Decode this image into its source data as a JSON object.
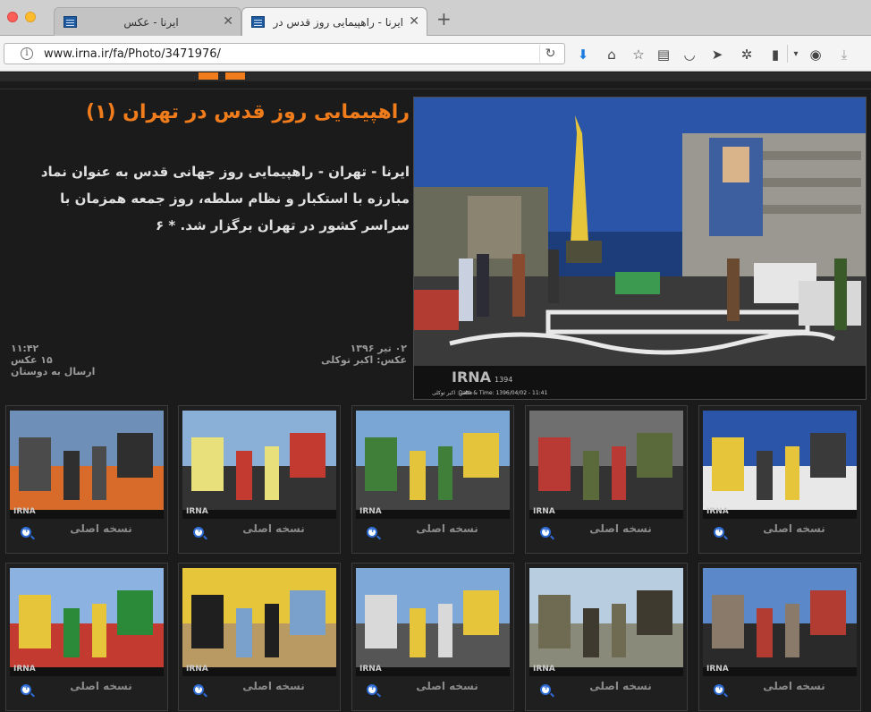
{
  "browser": {
    "tabs": [
      {
        "title": "ایرنا - عکس",
        "active": false
      },
      {
        "title": "ایرنا - راهپیمایی روز قدس در...",
        "active": true
      }
    ],
    "url": "www.irna.ir/fa/Photo/3471976/",
    "icons": [
      "download-icon",
      "home-icon",
      "bookmark-star-icon",
      "reading-list-icon",
      "pocket-icon",
      "send-icon",
      "extension-icon",
      "clipboard-icon",
      "menu-arrow-icon",
      "color-wheel-icon",
      "downloads-icon"
    ]
  },
  "article": {
    "title": "راهپیمایی روز قدس در تهران (۱)",
    "lead": "ایرنا - تهران - راهپیمایی روز جهانی قدس به عنوان نماد مبارزه با استکبار و نظام سلطه، روز جمعه همزمان با سراسر کشور در تهران برگزار شد. * ۶",
    "date": "۰۲ تیر ۱۳۹۶",
    "photographer": "عکس: اکبر توکلی",
    "time": "۱۱:۴۲",
    "photo_count": "۱۵ عکس",
    "send_to_friend": "ارسال به دوستان",
    "hero_watermark": "IRNA",
    "hero_year": "1394",
    "hero_caption": "عکاس: اکبر توکلی",
    "hero_datetime": "Date & Time: 1396/04/02 - 11:41"
  },
  "gallery": {
    "original_label": "نسخه اصلی",
    "thumb_watermark": "IRNA",
    "rows": 2,
    "columns": 5
  },
  "colors": {
    "accent": "#f07c1c",
    "background": "#1b1b1b",
    "text": "#e0e0e0",
    "muted": "#8a8a8a"
  }
}
